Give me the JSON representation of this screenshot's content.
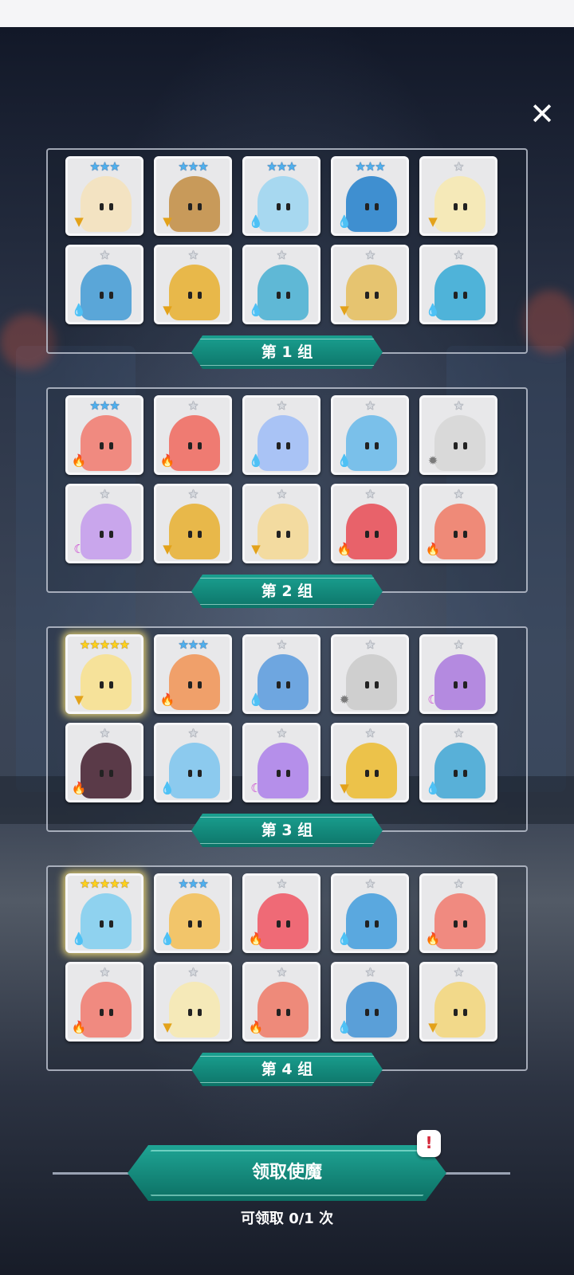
{
  "close_label": "✕",
  "groups": [
    {
      "label": "第 1 组",
      "cards": [
        {
          "stars": "★★★",
          "tier": "blue",
          "elem": "earth",
          "color": "#f3e3c2"
        },
        {
          "stars": "★★★",
          "tier": "blue",
          "elem": "earth",
          "color": "#c89a5a"
        },
        {
          "stars": "★★★",
          "tier": "blue",
          "elem": "water",
          "color": "#a7d8f0"
        },
        {
          "stars": "★★★",
          "tier": "blue",
          "elem": "water",
          "color": "#3f8fd0"
        },
        {
          "stars": "★",
          "tier": "silver",
          "elem": "earth",
          "color": "#f5e9b8"
        },
        {
          "stars": "★",
          "tier": "silver",
          "elem": "water",
          "color": "#5aa6d8"
        },
        {
          "stars": "★",
          "tier": "silver",
          "elem": "earth",
          "color": "#e8b84a"
        },
        {
          "stars": "★",
          "tier": "silver",
          "elem": "water",
          "color": "#5fb8d6"
        },
        {
          "stars": "★",
          "tier": "silver",
          "elem": "earth",
          "color": "#e6c470"
        },
        {
          "stars": "★",
          "tier": "silver",
          "elem": "water",
          "color": "#4fb3d9"
        }
      ]
    },
    {
      "label": "第 2 组",
      "cards": [
        {
          "stars": "★★★",
          "tier": "blue",
          "elem": "fire",
          "color": "#f08a80"
        },
        {
          "stars": "★",
          "tier": "silver",
          "elem": "fire",
          "color": "#ef7b72"
        },
        {
          "stars": "★",
          "tier": "silver",
          "elem": "water",
          "color": "#a9c3f5"
        },
        {
          "stars": "★",
          "tier": "silver",
          "elem": "water",
          "color": "#7ac0ea"
        },
        {
          "stars": "★",
          "tier": "silver",
          "elem": "light",
          "color": "#d9d9d9"
        },
        {
          "stars": "★",
          "tier": "silver",
          "elem": "dark",
          "color": "#c9a6ec"
        },
        {
          "stars": "★",
          "tier": "silver",
          "elem": "earth",
          "color": "#e8b84a"
        },
        {
          "stars": "★",
          "tier": "silver",
          "elem": "earth",
          "color": "#f3dba0"
        },
        {
          "stars": "★",
          "tier": "silver",
          "elem": "fire",
          "color": "#e8626a"
        },
        {
          "stars": "★",
          "tier": "silver",
          "elem": "fire",
          "color": "#ef8a78"
        }
      ]
    },
    {
      "label": "第 3 组",
      "cards": [
        {
          "stars": "★★★★★",
          "tier": "gold",
          "elem": "earth",
          "color": "#f6e29a"
        },
        {
          "stars": "★★★",
          "tier": "blue",
          "elem": "fire",
          "color": "#f0a06a"
        },
        {
          "stars": "★",
          "tier": "silver",
          "elem": "water",
          "color": "#6ea6e0"
        },
        {
          "stars": "★",
          "tier": "silver",
          "elem": "light",
          "color": "#cfcfcf"
        },
        {
          "stars": "★",
          "tier": "silver",
          "elem": "dark",
          "color": "#b48ae0"
        },
        {
          "stars": "★",
          "tier": "silver",
          "elem": "fire",
          "color": "#5a3a48"
        },
        {
          "stars": "★",
          "tier": "silver",
          "elem": "water",
          "color": "#8ccaee"
        },
        {
          "stars": "★",
          "tier": "silver",
          "elem": "dark",
          "color": "#b58fea"
        },
        {
          "stars": "★",
          "tier": "silver",
          "elem": "earth",
          "color": "#ecc24a"
        },
        {
          "stars": "★",
          "tier": "silver",
          "elem": "water",
          "color": "#58b0d8"
        }
      ]
    },
    {
      "label": "第 4 组",
      "cards": [
        {
          "stars": "★★★★★",
          "tier": "gold",
          "elem": "water",
          "color": "#8fd2ef"
        },
        {
          "stars": "★★★",
          "tier": "blue",
          "elem": "water",
          "color": "#f2c56a"
        },
        {
          "stars": "★",
          "tier": "silver",
          "elem": "fire",
          "color": "#ef6a76"
        },
        {
          "stars": "★",
          "tier": "silver",
          "elem": "water",
          "color": "#5aa8df"
        },
        {
          "stars": "★",
          "tier": "silver",
          "elem": "fire",
          "color": "#f08a80"
        },
        {
          "stars": "★",
          "tier": "silver",
          "elem": "fire",
          "color": "#f08a80"
        },
        {
          "stars": "★",
          "tier": "silver",
          "elem": "earth",
          "color": "#f5e9b8"
        },
        {
          "stars": "★",
          "tier": "silver",
          "elem": "fire",
          "color": "#ee8a7a"
        },
        {
          "stars": "★",
          "tier": "silver",
          "elem": "water",
          "color": "#5a9fd8"
        },
        {
          "stars": "★",
          "tier": "silver",
          "elem": "earth",
          "color": "#f2d98a"
        }
      ]
    }
  ],
  "element_icons": {
    "water": {
      "glyph": "💧",
      "color": "#2f86d4"
    },
    "fire": {
      "glyph": "🔥",
      "color": "#e0402a"
    },
    "earth": {
      "glyph": "▼",
      "color": "#e3a21a"
    },
    "light": {
      "glyph": "✹",
      "color": "#7a7a7a"
    },
    "dark": {
      "glyph": "☾",
      "color": "#c83ad0"
    }
  },
  "claim_button": {
    "label": "领取使魔",
    "badge": "!"
  },
  "claim_count": "可领取 0/1 次"
}
